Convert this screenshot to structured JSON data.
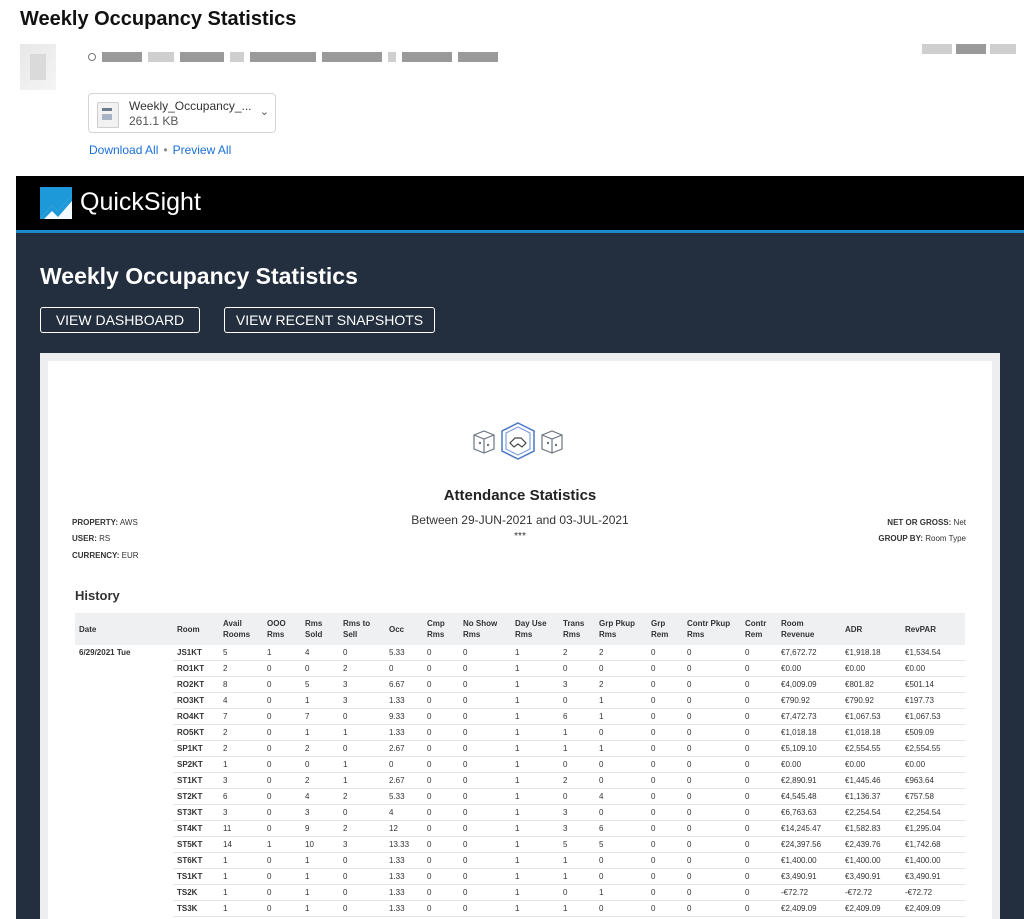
{
  "email": {
    "subject": "Weekly Occupancy Statistics",
    "attachment": {
      "name": "Weekly_Occupancy_...",
      "size": "261.1 KB"
    },
    "download_all": "Download All",
    "preview_all": "Preview All",
    "link_separator": "•"
  },
  "quicksight": {
    "brand": "QuickSight",
    "brand_color": "#1d98d8",
    "header_bg": "#000000",
    "body_bg": "#232f3e",
    "title": "Weekly Occupancy Statistics",
    "view_dashboard": "VIEW DASHBOARD",
    "view_snapshots": "VIEW RECENT SNAPSHOTS"
  },
  "report": {
    "title": "Attendance Statistics",
    "subtitle": "Between 29-JUN-2021 and 03-JUL-2021",
    "stars": "***",
    "property_label": "PROPERTY:",
    "property": "AWS",
    "user_label": "USER:",
    "user": "RS",
    "currency_label": "CURRENCY:",
    "currency": "EUR",
    "net_gross_label": "NET OR GROSS:",
    "net_gross": "Net",
    "group_by_label": "GROUP BY:",
    "group_by": "Room Type",
    "section": "History",
    "date": "6/29/2021 Tue",
    "columns": [
      "Date",
      "Room",
      "Avail Rooms",
      "OOO Rms",
      "Rms Sold",
      "Rms to Sell",
      "Occ",
      "Cmp Rms",
      "No Show Rms",
      "Day Use Rms",
      "Trans Rms",
      "Grp Pkup Rms",
      "Grp Rem",
      "Contr Pkup Rms",
      "Contr Rem",
      "Room Revenue",
      "ADR",
      "RevPAR"
    ],
    "rows": [
      [
        "JS1KT",
        "5",
        "1",
        "4",
        "0",
        "5.33",
        "0",
        "0",
        "1",
        "2",
        "2",
        "0",
        "0",
        "0",
        "€7,672.72",
        "€1,918.18",
        "€1,534.54"
      ],
      [
        "RO1KT",
        "2",
        "0",
        "0",
        "2",
        "0",
        "0",
        "0",
        "1",
        "0",
        "0",
        "0",
        "0",
        "0",
        "€0.00",
        "€0.00",
        "€0.00"
      ],
      [
        "RO2KT",
        "8",
        "0",
        "5",
        "3",
        "6.67",
        "0",
        "0",
        "1",
        "3",
        "2",
        "0",
        "0",
        "0",
        "€4,009.09",
        "€801.82",
        "€501.14"
      ],
      [
        "RO3KT",
        "4",
        "0",
        "1",
        "3",
        "1.33",
        "0",
        "0",
        "1",
        "0",
        "1",
        "0",
        "0",
        "0",
        "€790.92",
        "€790.92",
        "€197.73"
      ],
      [
        "RO4KT",
        "7",
        "0",
        "7",
        "0",
        "9.33",
        "0",
        "0",
        "1",
        "6",
        "1",
        "0",
        "0",
        "0",
        "€7,472.73",
        "€1,067.53",
        "€1,067.53"
      ],
      [
        "RO5KT",
        "2",
        "0",
        "1",
        "1",
        "1.33",
        "0",
        "0",
        "1",
        "1",
        "0",
        "0",
        "0",
        "0",
        "€1,018.18",
        "€1,018.18",
        "€509.09"
      ],
      [
        "SP1KT",
        "2",
        "0",
        "2",
        "0",
        "2.67",
        "0",
        "0",
        "1",
        "1",
        "1",
        "0",
        "0",
        "0",
        "€5,109.10",
        "€2,554.55",
        "€2,554.55"
      ],
      [
        "SP2KT",
        "1",
        "0",
        "0",
        "1",
        "0",
        "0",
        "0",
        "1",
        "0",
        "0",
        "0",
        "0",
        "0",
        "€0.00",
        "€0.00",
        "€0.00"
      ],
      [
        "ST1KT",
        "3",
        "0",
        "2",
        "1",
        "2.67",
        "0",
        "0",
        "1",
        "2",
        "0",
        "0",
        "0",
        "0",
        "€2,890.91",
        "€1,445.46",
        "€963.64"
      ],
      [
        "ST2KT",
        "6",
        "0",
        "4",
        "2",
        "5.33",
        "0",
        "0",
        "1",
        "0",
        "4",
        "0",
        "0",
        "0",
        "€4,545.48",
        "€1,136.37",
        "€757.58"
      ],
      [
        "ST3KT",
        "3",
        "0",
        "3",
        "0",
        "4",
        "0",
        "0",
        "1",
        "3",
        "0",
        "0",
        "0",
        "0",
        "€6,763.63",
        "€2,254.54",
        "€2,254.54"
      ],
      [
        "ST4KT",
        "11",
        "0",
        "9",
        "2",
        "12",
        "0",
        "0",
        "1",
        "3",
        "6",
        "0",
        "0",
        "0",
        "€14,245.47",
        "€1,582.83",
        "€1,295.04"
      ],
      [
        "ST5KT",
        "14",
        "1",
        "10",
        "3",
        "13.33",
        "0",
        "0",
        "1",
        "5",
        "5",
        "0",
        "0",
        "0",
        "€24,397.56",
        "€2,439.76",
        "€1,742.68"
      ],
      [
        "ST6KT",
        "1",
        "0",
        "1",
        "0",
        "1.33",
        "0",
        "0",
        "1",
        "1",
        "0",
        "0",
        "0",
        "0",
        "€1,400.00",
        "€1,400.00",
        "€1,400.00"
      ],
      [
        "TS1KT",
        "1",
        "0",
        "1",
        "0",
        "1.33",
        "0",
        "0",
        "1",
        "1",
        "0",
        "0",
        "0",
        "0",
        "€3,490.91",
        "€3,490.91",
        "€3,490.91"
      ],
      [
        "TS2K",
        "1",
        "0",
        "1",
        "0",
        "1.33",
        "0",
        "0",
        "1",
        "0",
        "1",
        "0",
        "0",
        "0",
        "-€72.72",
        "-€72.72",
        "-€72.72"
      ],
      [
        "TS3K",
        "1",
        "0",
        "1",
        "0",
        "1.33",
        "0",
        "0",
        "1",
        "1",
        "0",
        "0",
        "0",
        "0",
        "€2,409.09",
        "€2,409.09",
        "€2,409.09"
      ]
    ]
  }
}
